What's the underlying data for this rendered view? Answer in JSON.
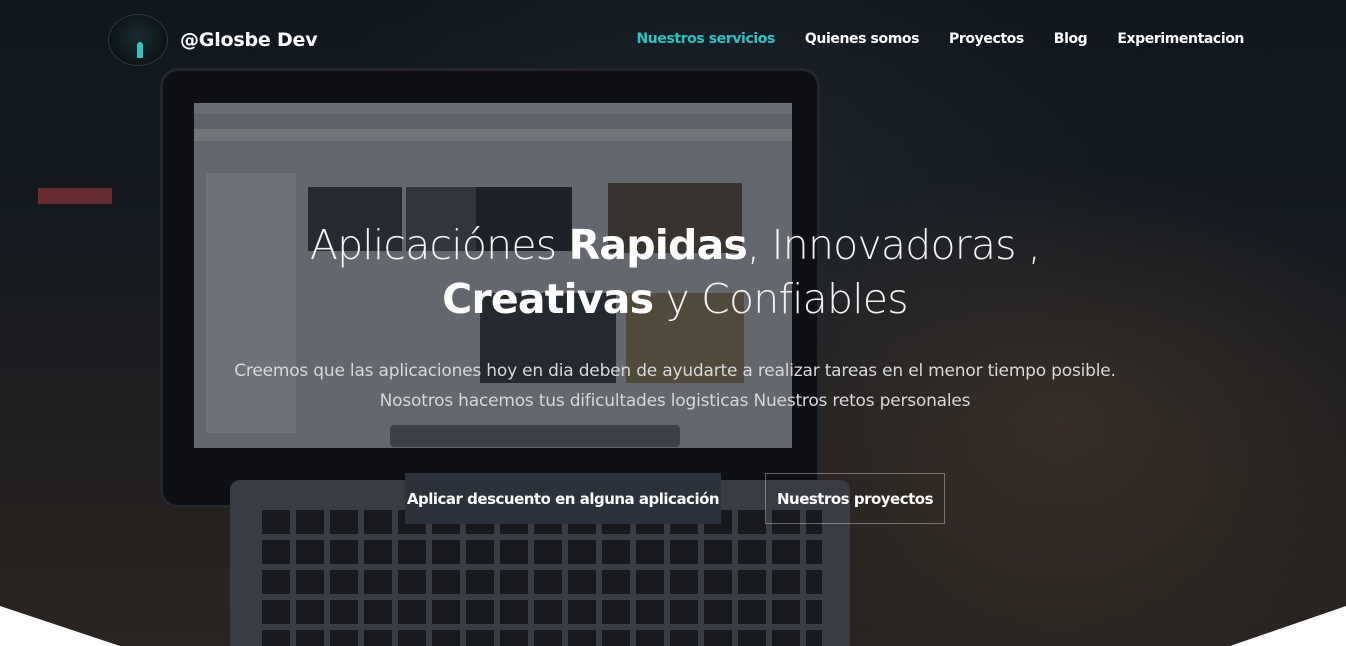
{
  "brand": {
    "name": "@Glosbe Dev",
    "logo_icon": "logo-figure-icon"
  },
  "nav": {
    "items": [
      {
        "label": "Nuestros servicios",
        "active": true
      },
      {
        "label": "Quienes somos",
        "active": false
      },
      {
        "label": "Proyectos",
        "active": false
      },
      {
        "label": "Blog",
        "active": false
      },
      {
        "label": "Experimentacion",
        "active": false
      }
    ],
    "active_color": "#29c5c5"
  },
  "hero": {
    "headline": {
      "part1": "Aplicaciónes ",
      "bold1": "Rapidas",
      "part2": ", Innovadoras , ",
      "bold2": "Creativas",
      "part3": " y Confiables"
    },
    "subtitle_line1": "Creemos que las aplicaciones hoy en dia deben de ayudarte a realizar tareas en el menor tiempo posible.",
    "subtitle_line2": "Nosotros hacemos tus dificultades logisticas Nuestros retos personales"
  },
  "buttons": {
    "primary_label": "Aplicar descuento en alguna aplicación",
    "secondary_label": "Nuestros proyectos"
  }
}
